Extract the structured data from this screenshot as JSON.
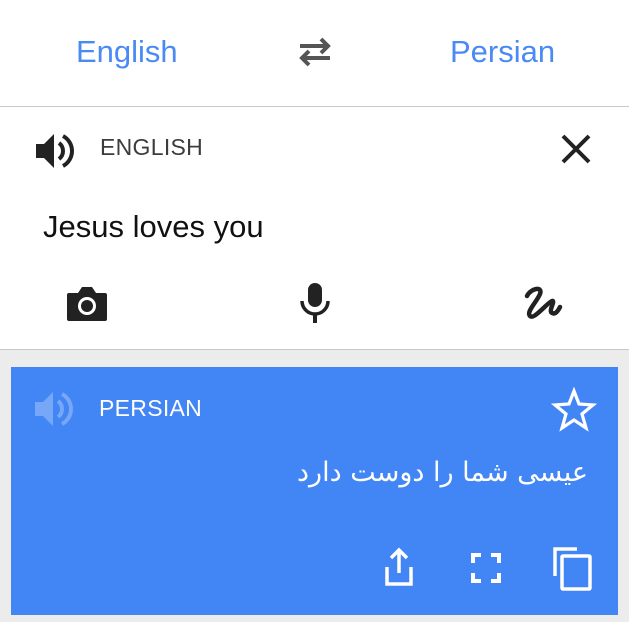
{
  "languages": {
    "source": "English",
    "target": "Persian"
  },
  "input": {
    "label": "ENGLISH",
    "text": "Jesus loves you"
  },
  "result": {
    "label": "PERSIAN",
    "text": "عیسی شما را دوست دارد"
  },
  "icons": {
    "swap": "swap-arrows-icon",
    "speaker": "speaker-icon",
    "close": "close-icon",
    "camera": "camera-icon",
    "mic": "microphone-icon",
    "handwriting": "handwriting-icon",
    "star": "star-outline-icon",
    "share": "share-icon",
    "fullscreen": "fullscreen-icon",
    "copy": "copy-icon"
  },
  "colors": {
    "accent": "#4285f4",
    "language_link": "#4a8af4",
    "background": "#ececec"
  }
}
